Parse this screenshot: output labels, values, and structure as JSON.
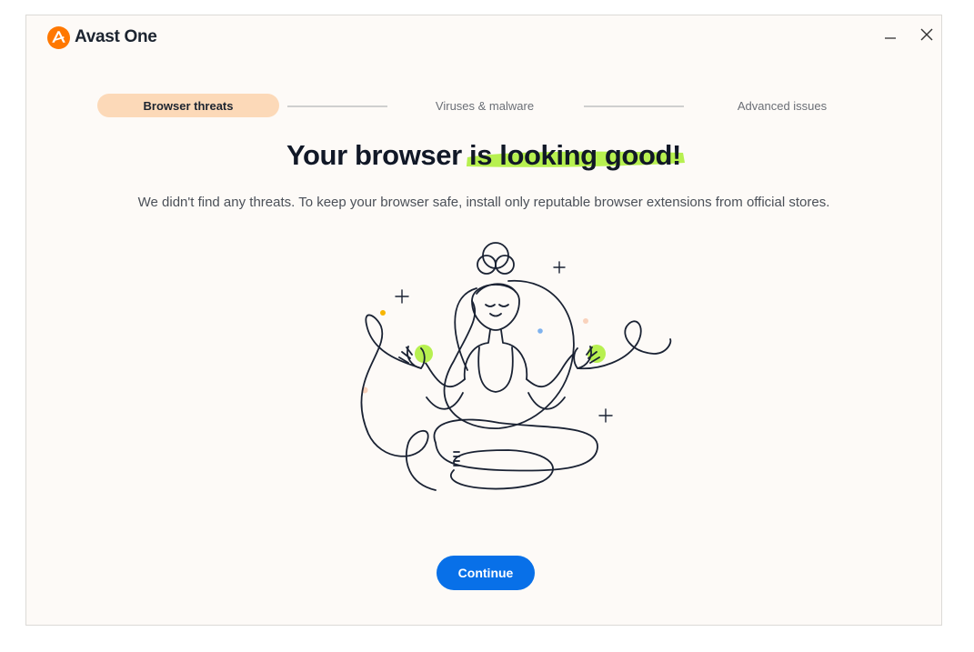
{
  "app": {
    "name": "Avast One",
    "brand_color": "#ff7800"
  },
  "window_controls": {
    "minimize_icon": "minimize-icon",
    "close_icon": "close-icon"
  },
  "steps": [
    {
      "label": "Browser threats",
      "state": "active"
    },
    {
      "label": "Viruses & malware",
      "state": "pending"
    },
    {
      "label": "Advanced issues",
      "state": "pending"
    }
  ],
  "headline": {
    "prefix": "Your browser ",
    "highlight": "is looking good!",
    "highlight_color": "#b7f050"
  },
  "subtitle": "We didn't find any threats. To keep your browser safe, install only reputable browser extensions from official stores.",
  "illustration": {
    "icon": "meditating-person-illustration"
  },
  "continue_button": {
    "label": "Continue",
    "color": "#0870e8"
  }
}
